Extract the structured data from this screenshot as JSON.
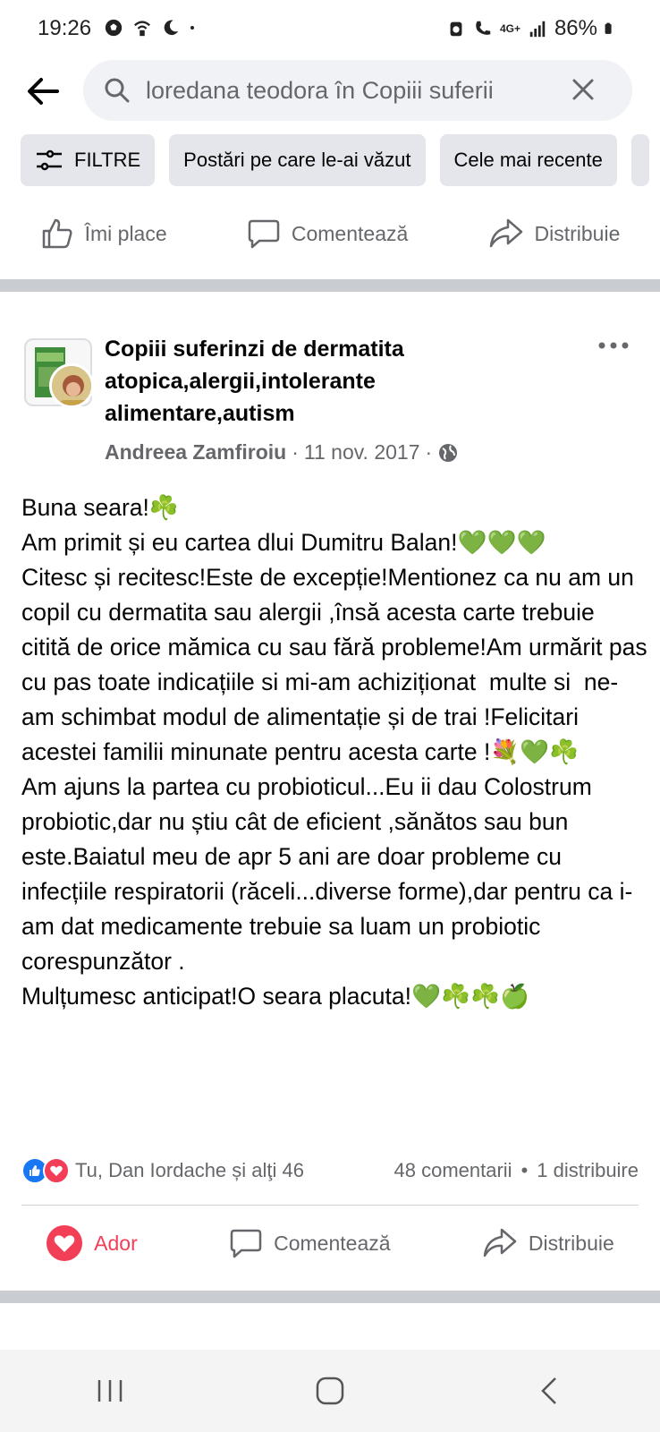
{
  "status_bar": {
    "time": "19:26",
    "network": "4G+",
    "battery": "86%"
  },
  "search": {
    "query": "loredana teodora în Copiii suferii"
  },
  "filters": {
    "filter_label": "FILTRE",
    "chips": [
      "Postări pe care le-ai văzut",
      "Cele mai recente"
    ]
  },
  "top_actions": {
    "like": "Îmi place",
    "comment": "Comentează",
    "share": "Distribuie"
  },
  "post": {
    "group_name": "Copiii suferinzi de dermatita atopica,alergii,intolerante alimentare,autism",
    "author": "Andreea Zamfiroiu",
    "date": "11 nov. 2017",
    "dot": "·",
    "body_lines": [
      "Buna seara!☘️",
      "Am primit și eu cartea dlui Dumitru Balan!💚💚💚",
      "Citesc și recitesc!Este de excepție!Mentionez ca nu am un copil cu dermatita sau alergii ,însă acesta carte trebuie citită de orice mămica cu sau fără probleme!Am urmărit pas cu pas toate indicațiile si mi-am achiziționat  multe si  ne-am schimbat modul de alimentație și de trai !Felicitari acestei familii minunate pentru acesta carte !💐💚☘️",
      "Am ajuns la partea cu probioticul...Eu ii dau Colostrum probiotic,dar nu știu cât de eficient ,sănătos sau bun este.Baiatul meu de apr 5 ani are doar probleme cu infecțiile respiratorii (răceli...diverse forme),dar pentru ca i-am dat medicamente trebuie sa luam un probiotic corespunzător .",
      "Mulțumesc anticipat!O seara placuta!💚☘️☘️🍏"
    ],
    "reactions_text": "Tu, Dan Iordache și alţi 46",
    "comments_count": "48 comentarii",
    "shares_count": "1 distribuire",
    "bullet": "•"
  },
  "bottom_actions": {
    "love": "Ador",
    "comment": "Comentează",
    "share": "Distribuie"
  },
  "colors": {
    "love_red": "#f33e58",
    "like_blue": "#1877f2",
    "muted_text": "#65676b",
    "separator": "#c9ccd1"
  }
}
